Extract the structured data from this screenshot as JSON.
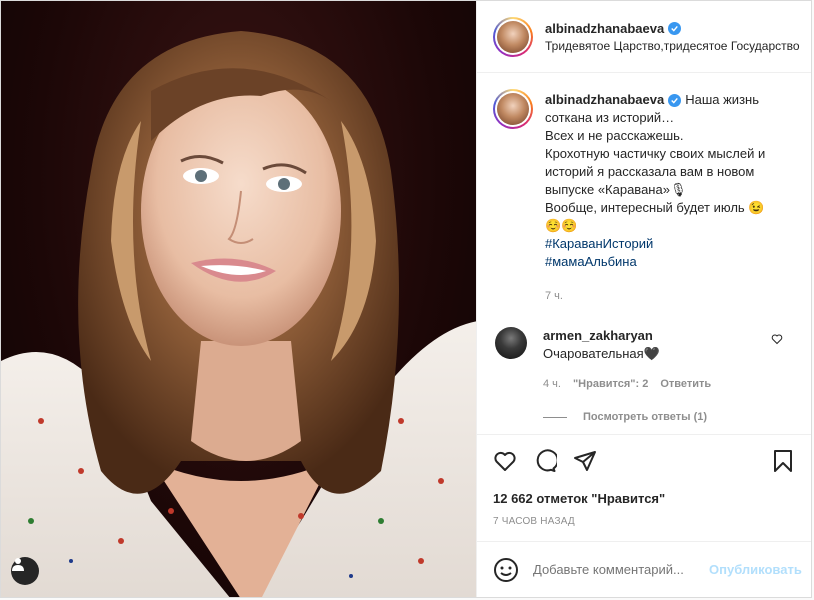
{
  "post": {
    "username": "albinadzhanabaeva",
    "location": "Тридевятое Царство,тридесятое Государство",
    "caption_lines": [
      "Наша жизнь",
      "соткана из историй…",
      "Всех и не расскажешь.",
      "Крохотную частичку своих мыслей и",
      "историй я рассказала вам в новом",
      "выпуске «Каравана»🎙",
      "Вообще, интересный будет июль 😉",
      "☺️☺️"
    ],
    "hashtags": [
      "#КараванИсторий",
      "#мамаАльбина"
    ],
    "caption_time": "7 ч."
  },
  "comment": {
    "username": "armen_zakharyan",
    "text": "Очаровательная🖤",
    "time": "4 ч.",
    "likes": "\"Нравится\": 2",
    "reply": "Ответить",
    "view_replies": "Посмотреть ответы (1)"
  },
  "likes_text": "12 662 отметок \"Нравится\"",
  "posted_ago": "7 ЧАСОВ НАЗАД",
  "add_comment": {
    "placeholder": "Добавьте комментарий...",
    "publish": "Опубликовать"
  },
  "colors": {
    "verified": "#3897f0",
    "hashtag": "#00376b",
    "publish_disabled": "#b2dffc"
  }
}
